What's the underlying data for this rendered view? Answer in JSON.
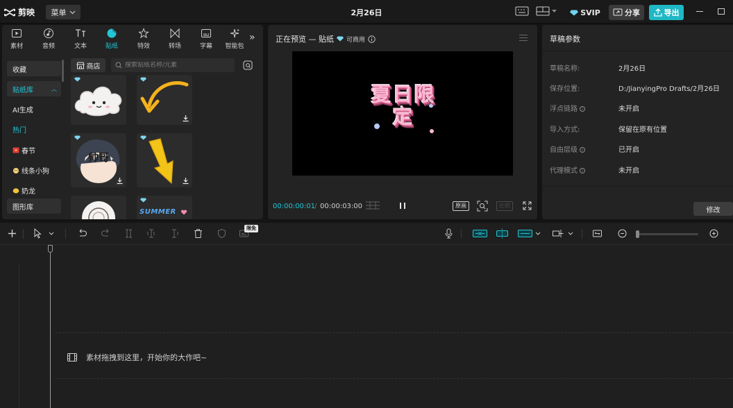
{
  "app": {
    "name": "剪映",
    "menu_label": "菜单",
    "title": "2月26日",
    "svip_label": "SVIP",
    "share_label": "分享",
    "export_label": "导出"
  },
  "tool_tabs": [
    {
      "label": "素材"
    },
    {
      "label": "音频"
    },
    {
      "label": "文本"
    },
    {
      "label": "贴纸"
    },
    {
      "label": "特效"
    },
    {
      "label": "转场"
    },
    {
      "label": "字幕"
    },
    {
      "label": "智能包"
    }
  ],
  "active_tab": "贴纸",
  "sidebar": {
    "items": [
      {
        "label": "收藏"
      },
      {
        "label": "贴纸库"
      },
      {
        "label": "AI生成"
      },
      {
        "label": "热门"
      },
      {
        "label": "春节"
      },
      {
        "label": "线条小狗"
      },
      {
        "label": "奶龙"
      },
      {
        "label": "图形库"
      }
    ]
  },
  "store": {
    "label": "商店",
    "search_placeholder": "搜索贴纸名称/元素"
  },
  "stickers": [
    {
      "name": "cloud"
    },
    {
      "name": "arrow-curve"
    },
    {
      "name": "shuai-ge"
    },
    {
      "name": "arrow-down"
    },
    {
      "name": "ring"
    },
    {
      "name": "summer"
    }
  ],
  "sticker_texts": {
    "shuai_ge": "帅哥",
    "summer": "SUMMER"
  },
  "preview": {
    "title": "正在预览 — 贴纸",
    "commercial": "可商用",
    "sticker_text": "夏日限定",
    "current_time": "00:00:00:01",
    "total_time": "00:00:03:00",
    "original_label": "原画",
    "ratio_label": "比例"
  },
  "draft": {
    "title": "草稿参数",
    "rows": [
      {
        "key": "草稿名称:",
        "value": "2月26日",
        "info": false
      },
      {
        "key": "保存位置:",
        "value": "D:/JianyingPro Drafts/2月26日",
        "info": false
      },
      {
        "key": "浮点链路",
        "value": "未开启",
        "info": true
      },
      {
        "key": "导入方式:",
        "value": "保留在原有位置",
        "info": false
      },
      {
        "key": "自由层级",
        "value": "已开启",
        "info": true
      },
      {
        "key": "代理模式",
        "value": "未开启",
        "info": true
      }
    ],
    "modify_label": "修改"
  },
  "timeline": {
    "free_badge": "限免",
    "drop_hint": "素材拖拽到这里，开始你的大作吧~"
  },
  "colors": {
    "accent": "#22c6d6",
    "export": "#1fb8c5"
  }
}
